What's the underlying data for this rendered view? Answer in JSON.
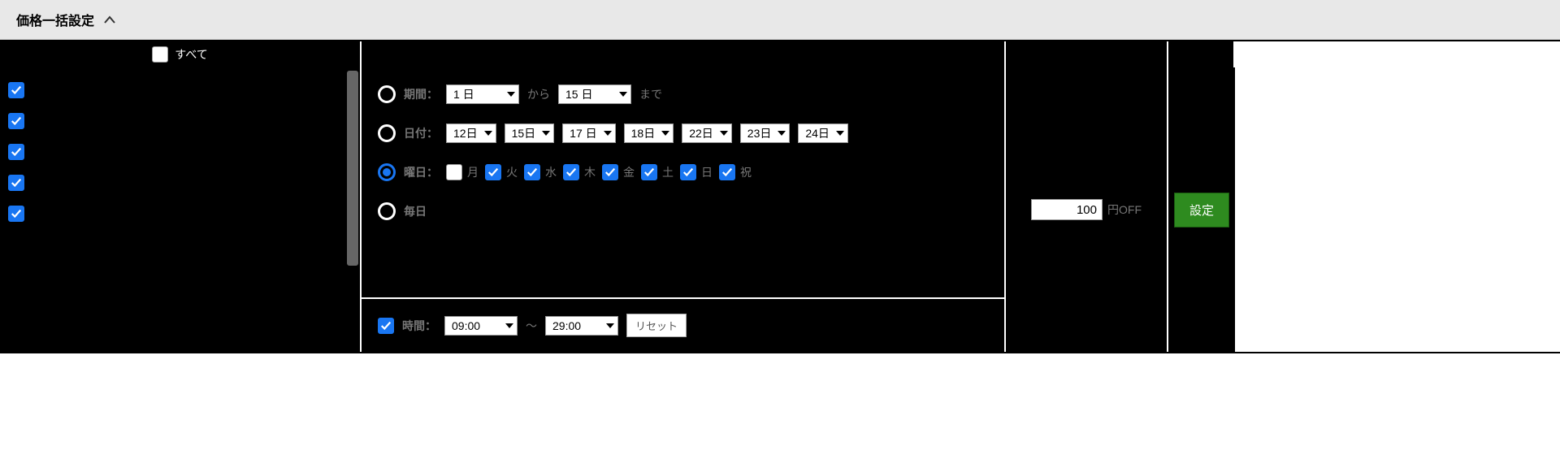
{
  "header": {
    "title": "価格一括設定"
  },
  "table_header": {
    "all_label": "すべて"
  },
  "mid": {
    "period": {
      "label": "期間：",
      "from_value": "1 日",
      "from_suffix": "から",
      "to_value": "15 日",
      "to_suffix": "まで"
    },
    "dates": {
      "label": "日付：",
      "values": [
        "12日",
        "15日",
        "17 日",
        "18日",
        "22日",
        "23日",
        "24日"
      ]
    },
    "weekdays": {
      "label": "曜日：",
      "items": [
        {
          "label": "月",
          "checked": false
        },
        {
          "label": "火",
          "checked": true
        },
        {
          "label": "水",
          "checked": true
        },
        {
          "label": "木",
          "checked": true
        },
        {
          "label": "金",
          "checked": true
        },
        {
          "label": "土",
          "checked": true
        },
        {
          "label": "日",
          "checked": true
        },
        {
          "label": "祝",
          "checked": true
        }
      ]
    },
    "everyday": {
      "label": "毎日"
    },
    "time": {
      "label": "時間：",
      "from": "09:00",
      "sep": "〜",
      "to": "29:00",
      "reset": "リセット",
      "checked": true
    }
  },
  "price": {
    "value": "100",
    "suffix": "円OFF"
  },
  "action": {
    "label": "設定"
  }
}
